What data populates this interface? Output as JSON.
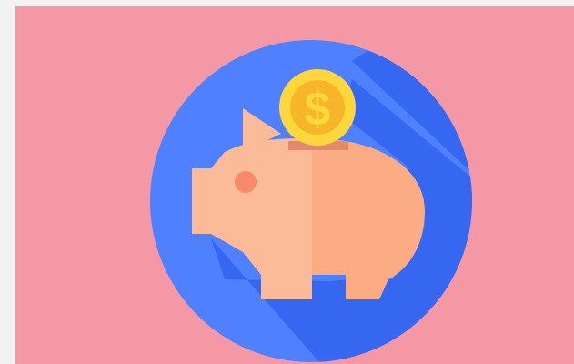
{
  "illustration": {
    "subject": "piggy-bank-with-dollar-coin",
    "icons": [
      "piggy-bank-icon",
      "dollar-coin-icon"
    ],
    "coin_symbol": "$",
    "colors": {
      "page_background": "#f2f2f2",
      "panel_background": "#f498a6",
      "circle": "#4f80ff",
      "long_shadow": "#3567f0",
      "pig_light": "#fbbb98",
      "pig_dark": "#fcac82",
      "pig_eye": "#f68a6b",
      "coin_slot": "#e38a6d",
      "coin_outer": "#fdd73b",
      "coin_inner": "#f7b529",
      "coin_symbol": "#fdd73b"
    }
  }
}
